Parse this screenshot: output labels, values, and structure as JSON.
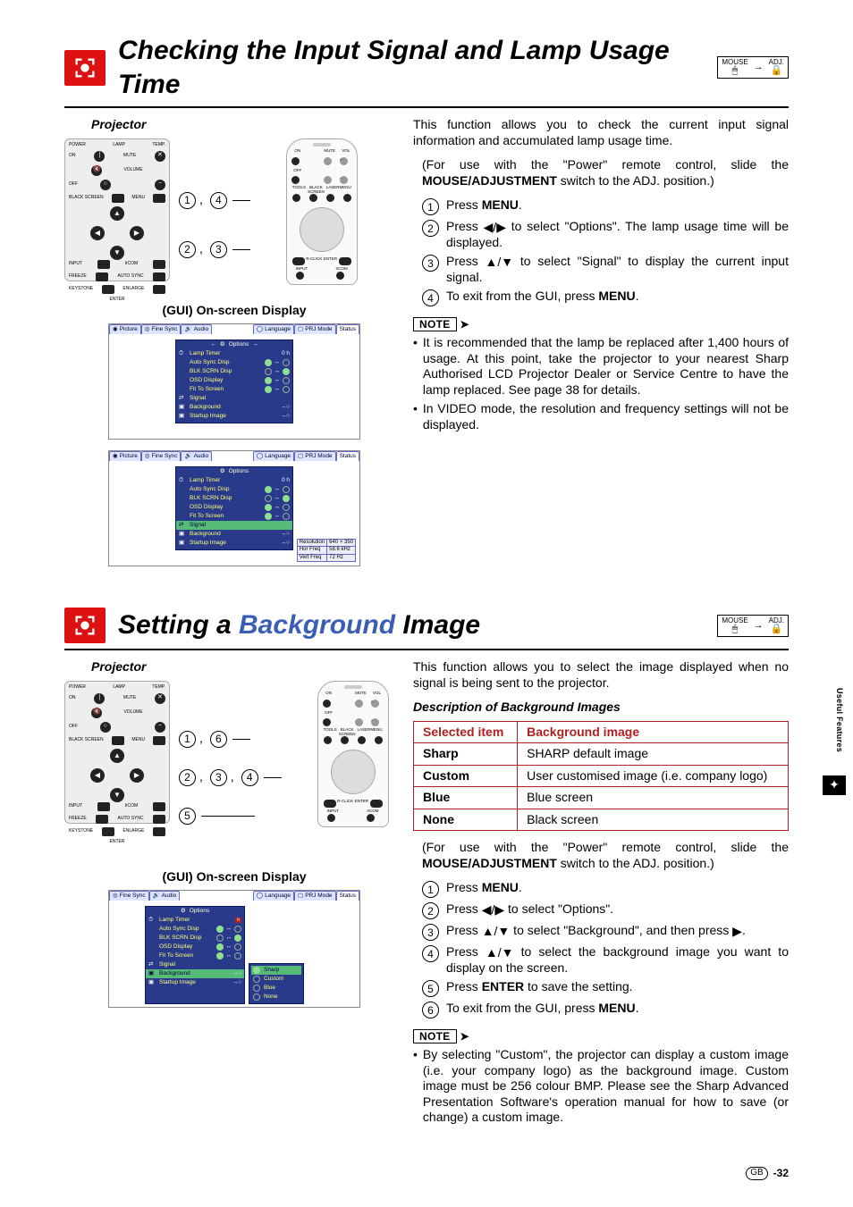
{
  "header1": {
    "title": "Checking the Input Signal and Lamp Usage Time",
    "mouse_label": "MOUSE",
    "adj_label": "ADJ."
  },
  "proj_label": "Projector",
  "gui_heading": "(GUI) On-screen Display",
  "section1": {
    "callouts": [
      {
        "nums": "1, 4"
      },
      {
        "nums": "2, 3"
      }
    ],
    "gui_tabs": [
      "Picture",
      "Fine Sync",
      "Audio",
      "Options",
      "Language",
      "PRJ Mode",
      "Status"
    ],
    "options_menu": {
      "title": "Options",
      "rows": [
        {
          "label": "Lamp Timer",
          "value": "0 h"
        },
        {
          "label": "Auto Sync Disp",
          "value": "on"
        },
        {
          "label": "BLK SCRN Disp",
          "value": "on"
        },
        {
          "label": "OSD Display",
          "value": "on"
        },
        {
          "label": "Fit To Screen",
          "value": "on"
        },
        {
          "label": "Signal",
          "value": ""
        },
        {
          "label": "Background",
          "value": "→"
        },
        {
          "label": "Startup Image",
          "value": "→"
        }
      ]
    },
    "signal_table": [
      [
        "Resolution",
        "640 × 350"
      ],
      [
        "Hor Freq",
        "58.6 kHz"
      ],
      [
        "Vert Freq",
        "72 Hz"
      ]
    ],
    "intro": "This function allows you to check the current input signal information and accumulated lamp usage time.",
    "prelude_a": "(For use with the \"Power\" remote control, slide the ",
    "prelude_b": "MOUSE/ADJUSTMENT",
    "prelude_c": " switch to the ADJ. position.)",
    "steps": [
      {
        "n": "1",
        "a": "Press ",
        "b": "MENU",
        "c": "."
      },
      {
        "n": "2",
        "a": "Press ",
        "dir": "lr",
        "c": " to select \"Options\". The lamp usage time will be displayed."
      },
      {
        "n": "3",
        "a": "Press ",
        "dir": "ud",
        "c": " to select \"Signal\" to display the current input signal."
      },
      {
        "n": "4",
        "a": "To exit from the GUI, press ",
        "b": "MENU",
        "c": "."
      }
    ],
    "note_label": "NOTE",
    "notes": [
      "It is recommended that the lamp be replaced after 1,400 hours of usage. At this point, take the projector to your nearest Sharp Authorised LCD Projector Dealer or Service Centre to have the lamp replaced. See page 38 for details.",
      "In VIDEO mode, the resolution and frequency settings will not be displayed."
    ]
  },
  "header2": {
    "pre": "Setting a ",
    "accent": "Background",
    "post": " Image",
    "mouse_label": "MOUSE",
    "adj_label": "ADJ."
  },
  "section2": {
    "callouts": [
      {
        "nums": "1, 6"
      },
      {
        "nums": "2, 3, 4"
      },
      {
        "nums": "5"
      }
    ],
    "bg_submenu": [
      "Sharp",
      "Custom",
      "Blue",
      "None"
    ],
    "intro": "This function allows you to select the image displayed when no signal is being sent to the projector.",
    "desc_heading": "Description of Background Images",
    "table_head": [
      "Selected item",
      "Background image"
    ],
    "table_rows": [
      [
        "Sharp",
        "SHARP default image"
      ],
      [
        "Custom",
        "User customised image (i.e. company logo)"
      ],
      [
        "Blue",
        "Blue screen"
      ],
      [
        "None",
        "Black screen"
      ]
    ],
    "prelude_a": "(For use with the \"Power\" remote control, slide the ",
    "prelude_b": "MOUSE/ADJUSTMENT",
    "prelude_c": " switch to the ADJ. position.)",
    "steps": [
      {
        "n": "1",
        "a": "Press ",
        "b": "MENU",
        "c": "."
      },
      {
        "n": "2",
        "a": "Press ",
        "dir": "lr",
        "c": " to select \"Options\"."
      },
      {
        "n": "3",
        "a": "Press ",
        "dir": "ud",
        "c": " to select \"Background\", and then press ",
        "dir2": "r",
        "c2": "."
      },
      {
        "n": "4",
        "a": "Press ",
        "dir": "ud",
        "c": " to select the background image you want to display on the screen."
      },
      {
        "n": "5",
        "a": "Press ",
        "b": "ENTER",
        "c": " to save the setting."
      },
      {
        "n": "6",
        "a": "To exit from the GUI, press ",
        "b": "MENU",
        "c": "."
      }
    ],
    "note_label": "NOTE",
    "notes": [
      "By selecting \"Custom\", the projector can display a custom image (i.e. your company logo) as the background image. Custom image must be 256 colour BMP. Please see the Sharp Advanced Presentation Software's operation manual for how to save (or change) a custom image."
    ]
  },
  "side_tab": "Useful Features",
  "footer": {
    "gb": "GB",
    "page": "-32"
  },
  "panel": {
    "power": "POWER",
    "lamp": "LAMP",
    "temp": "TEMP.",
    "on": "ON",
    "mute": "MUTE",
    "off": "OFF",
    "volume": "VOLUME",
    "black_screen": "BLACK\nSCREEN",
    "menu": "MENU",
    "input": "INPUT",
    "ircom": "IrCOM",
    "freeze": "FREEZE",
    "auto_sync": "AUTO SYNC",
    "enlarge": "ENLARGE",
    "keystone": "KEYSTONE",
    "enter": "ENTER",
    "tools": "TOOLS",
    "laser": "LASER",
    "vol": "VOL",
    "rclick": "R-CLICK"
  }
}
